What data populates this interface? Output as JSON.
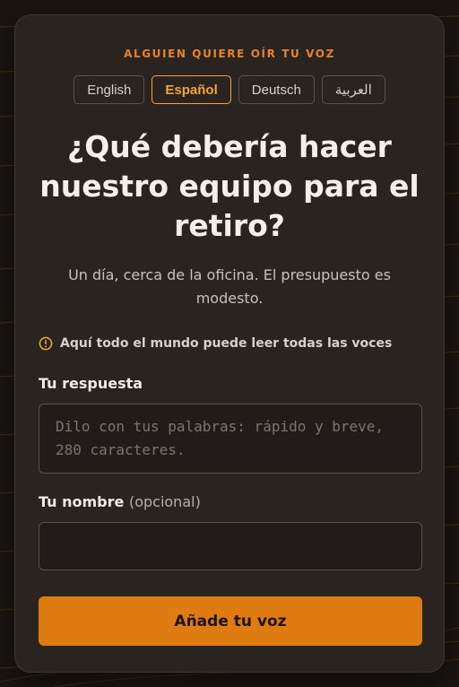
{
  "header": {
    "kicker": "ALGUIEN QUIERE OÍR TU VOZ"
  },
  "languages": [
    {
      "label": "English",
      "active": false
    },
    {
      "label": "Español",
      "active": true
    },
    {
      "label": "Deutsch",
      "active": false
    },
    {
      "label": "العربية",
      "active": false
    }
  ],
  "question": {
    "title": "¿Qué debería hacer nuestro equipo para el retiro?",
    "subtitle": "Un día, cerca de la oficina. El presupuesto es modesto."
  },
  "notice": {
    "icon": "warning-circle-icon",
    "text": "Aquí todo el mundo puede leer todas las voces"
  },
  "form": {
    "response_label": "Tu respuesta",
    "response_placeholder": "Dilo con tus palabras: rápido y breve, 280 caracteres.",
    "response_value": "",
    "name_label": "Tu nombre",
    "name_optional": "(opcional)",
    "name_value": "",
    "submit_label": "Añade tu voz"
  },
  "colors": {
    "accent": "#e8832a",
    "button": "#df7c11",
    "card_bg": "#2a2420",
    "page_bg": "#1a1511"
  }
}
